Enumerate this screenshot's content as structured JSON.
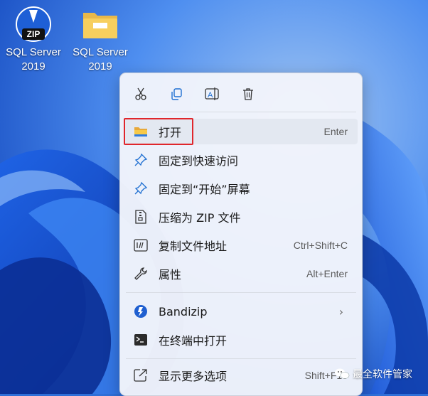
{
  "desktop": {
    "icons": [
      {
        "label_line1": "SQL Server",
        "label_line2": "2019",
        "type": "zip-archive-icon",
        "badge": "ZIP"
      },
      {
        "label_line1": "SQL Server",
        "label_line2": "2019",
        "type": "folder-icon"
      }
    ]
  },
  "context_menu": {
    "toolbar": [
      "cut-icon",
      "copy-icon",
      "rename-icon",
      "delete-icon"
    ],
    "items": [
      {
        "label": "打开",
        "shortcut": "Enter",
        "icon": "folder-icon",
        "highlighted": true
      },
      {
        "label": "固定到快速访问",
        "shortcut": "",
        "icon": "pin-icon"
      },
      {
        "label": "固定到“开始”屏幕",
        "shortcut": "",
        "icon": "pin-icon"
      },
      {
        "label": "压缩为 ZIP 文件",
        "shortcut": "",
        "icon": "zip-file-icon"
      },
      {
        "label": "复制文件地址",
        "shortcut": "Ctrl+Shift+C",
        "icon": "copy-path-icon"
      },
      {
        "label": "属性",
        "shortcut": "Alt+Enter",
        "icon": "wrench-icon"
      },
      {
        "label": "Bandizip",
        "shortcut": "",
        "icon": "bandizip-icon",
        "submenu": true
      },
      {
        "label": "在终端中打开",
        "shortcut": "",
        "icon": "terminal-icon"
      },
      {
        "label": "显示更多选项",
        "shortcut": "Shift+F10",
        "icon": "more-options-icon"
      }
    ]
  },
  "watermark": {
    "text": "最全软件管家"
  },
  "colors": {
    "highlight_box": "#e0262c",
    "accent": "#0067c0"
  }
}
